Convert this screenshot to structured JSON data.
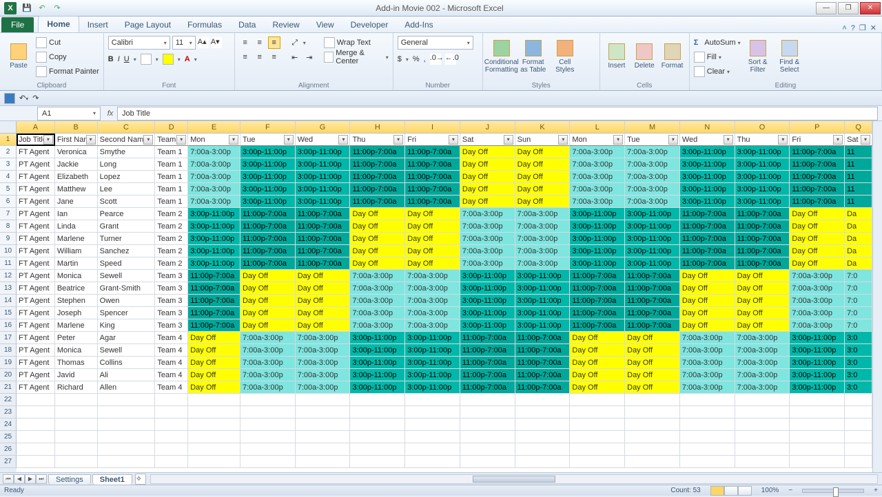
{
  "title": "Add-in Movie 002 - Microsoft Excel",
  "ribbon": {
    "file": "File",
    "tabs": [
      "Home",
      "Insert",
      "Page Layout",
      "Formulas",
      "Data",
      "Review",
      "View",
      "Developer",
      "Add-Ins"
    ],
    "active_tab": "Home",
    "clipboard": {
      "paste": "Paste",
      "cut": "Cut",
      "copy": "Copy",
      "fmtpainter": "Format Painter",
      "label": "Clipboard"
    },
    "font": {
      "name": "Calibri",
      "size": "11",
      "label": "Font"
    },
    "alignment": {
      "wrap": "Wrap Text",
      "merge": "Merge & Center",
      "label": "Alignment"
    },
    "number": {
      "format": "General",
      "label": "Number"
    },
    "styles": {
      "cond": "Conditional Formatting",
      "fmttbl": "Format as Table",
      "cellsty": "Cell Styles",
      "label": "Styles"
    },
    "cells": {
      "insert": "Insert",
      "delete": "Delete",
      "format": "Format",
      "label": "Cells"
    },
    "editing": {
      "autosum": "AutoSum",
      "fill": "Fill",
      "clear": "Clear",
      "sort": "Sort & Filter",
      "find": "Find & Select",
      "label": "Editing"
    }
  },
  "namebox": "A1",
  "formula": "Job Title",
  "columns": [
    {
      "letter": "A",
      "w": 56,
      "h": "Job Title"
    },
    {
      "letter": "B",
      "w": 62,
      "h": "First Name"
    },
    {
      "letter": "C",
      "w": 84,
      "h": "Second Name"
    },
    {
      "letter": "D",
      "w": 48,
      "h": "Team"
    },
    {
      "letter": "E",
      "w": 76,
      "h": "Mon"
    },
    {
      "letter": "F",
      "w": 80,
      "h": "Tue"
    },
    {
      "letter": "G",
      "w": 80,
      "h": "Wed"
    },
    {
      "letter": "H",
      "w": 80,
      "h": "Thu"
    },
    {
      "letter": "I",
      "w": 80,
      "h": "Fri"
    },
    {
      "letter": "J",
      "w": 80,
      "h": "Sat"
    },
    {
      "letter": "K",
      "w": 80,
      "h": "Sun"
    },
    {
      "letter": "L",
      "w": 80,
      "h": "Mon"
    },
    {
      "letter": "M",
      "w": 80,
      "h": "Tue"
    },
    {
      "letter": "N",
      "w": 80,
      "h": "Wed"
    },
    {
      "letter": "O",
      "w": 80,
      "h": "Thu"
    },
    {
      "letter": "P",
      "w": 80,
      "h": "Fri"
    },
    {
      "letter": "Q",
      "w": 40,
      "h": "Sat"
    }
  ],
  "shiftStyles": {
    "7:00a-3:00p": "c-m",
    "3:00p-11:00p": "c-a",
    "11:00p-7:00a": "c-n",
    "Day Off": "c-o"
  },
  "rows": [
    {
      "n": 2,
      "job": "FT Agent",
      "fn": "Veronica",
      "sn": "Smythe",
      "team": "Team 1",
      "s": [
        "7:00a-3:00p",
        "3:00p-11:00p",
        "3:00p-11:00p",
        "11:00p-7:00a",
        "11:00p-7:00a",
        "Day Off",
        "Day Off",
        "7:00a-3:00p",
        "7:00a-3:00p",
        "3:00p-11:00p",
        "3:00p-11:00p",
        "11:00p-7:00a",
        "11"
      ]
    },
    {
      "n": 3,
      "job": "PT Agent",
      "fn": "Jackie",
      "sn": "Long",
      "team": "Team 1",
      "s": [
        "7:00a-3:00p",
        "3:00p-11:00p",
        "3:00p-11:00p",
        "11:00p-7:00a",
        "11:00p-7:00a",
        "Day Off",
        "Day Off",
        "7:00a-3:00p",
        "7:00a-3:00p",
        "3:00p-11:00p",
        "3:00p-11:00p",
        "11:00p-7:00a",
        "11"
      ]
    },
    {
      "n": 4,
      "job": "FT Agent",
      "fn": "Elizabeth",
      "sn": "Lopez",
      "team": "Team 1",
      "s": [
        "7:00a-3:00p",
        "3:00p-11:00p",
        "3:00p-11:00p",
        "11:00p-7:00a",
        "11:00p-7:00a",
        "Day Off",
        "Day Off",
        "7:00a-3:00p",
        "7:00a-3:00p",
        "3:00p-11:00p",
        "3:00p-11:00p",
        "11:00p-7:00a",
        "11"
      ]
    },
    {
      "n": 5,
      "job": "FT Agent",
      "fn": "Matthew",
      "sn": "Lee",
      "team": "Team 1",
      "s": [
        "7:00a-3:00p",
        "3:00p-11:00p",
        "3:00p-11:00p",
        "11:00p-7:00a",
        "11:00p-7:00a",
        "Day Off",
        "Day Off",
        "7:00a-3:00p",
        "7:00a-3:00p",
        "3:00p-11:00p",
        "3:00p-11:00p",
        "11:00p-7:00a",
        "11"
      ]
    },
    {
      "n": 6,
      "job": "FT Agent",
      "fn": "Jane",
      "sn": "Scott",
      "team": "Team 1",
      "s": [
        "7:00a-3:00p",
        "3:00p-11:00p",
        "3:00p-11:00p",
        "11:00p-7:00a",
        "11:00p-7:00a",
        "Day Off",
        "Day Off",
        "7:00a-3:00p",
        "7:00a-3:00p",
        "3:00p-11:00p",
        "3:00p-11:00p",
        "11:00p-7:00a",
        "11"
      ]
    },
    {
      "n": 7,
      "job": "PT Agent",
      "fn": "Ian",
      "sn": "Pearce",
      "team": "Team 2",
      "s": [
        "3:00p-11:00p",
        "11:00p-7:00a",
        "11:00p-7:00a",
        "Day Off",
        "Day Off",
        "7:00a-3:00p",
        "7:00a-3:00p",
        "3:00p-11:00p",
        "3:00p-11:00p",
        "11:00p-7:00a",
        "11:00p-7:00a",
        "Day Off",
        "Da"
      ]
    },
    {
      "n": 8,
      "job": "FT Agent",
      "fn": "Linda",
      "sn": "Grant",
      "team": "Team 2",
      "s": [
        "3:00p-11:00p",
        "11:00p-7:00a",
        "11:00p-7:00a",
        "Day Off",
        "Day Off",
        "7:00a-3:00p",
        "7:00a-3:00p",
        "3:00p-11:00p",
        "3:00p-11:00p",
        "11:00p-7:00a",
        "11:00p-7:00a",
        "Day Off",
        "Da"
      ]
    },
    {
      "n": 9,
      "job": "FT Agent",
      "fn": "Marlene",
      "sn": "Turner",
      "team": "Team 2",
      "s": [
        "3:00p-11:00p",
        "11:00p-7:00a",
        "11:00p-7:00a",
        "Day Off",
        "Day Off",
        "7:00a-3:00p",
        "7:00a-3:00p",
        "3:00p-11:00p",
        "3:00p-11:00p",
        "11:00p-7:00a",
        "11:00p-7:00a",
        "Day Off",
        "Da"
      ]
    },
    {
      "n": 10,
      "job": "FT Agent",
      "fn": "William",
      "sn": "Sanchez",
      "team": "Team 2",
      "s": [
        "3:00p-11:00p",
        "11:00p-7:00a",
        "11:00p-7:00a",
        "Day Off",
        "Day Off",
        "7:00a-3:00p",
        "7:00a-3:00p",
        "3:00p-11:00p",
        "3:00p-11:00p",
        "11:00p-7:00a",
        "11:00p-7:00a",
        "Day Off",
        "Da"
      ]
    },
    {
      "n": 11,
      "job": "FT Agent",
      "fn": "Martin",
      "sn": "Speed",
      "team": "Team 2",
      "s": [
        "3:00p-11:00p",
        "11:00p-7:00a",
        "11:00p-7:00a",
        "Day Off",
        "Day Off",
        "7:00a-3:00p",
        "7:00a-3:00p",
        "3:00p-11:00p",
        "3:00p-11:00p",
        "11:00p-7:00a",
        "11:00p-7:00a",
        "Day Off",
        "Da"
      ]
    },
    {
      "n": 12,
      "job": "PT Agent",
      "fn": "Monica",
      "sn": "Sewell",
      "team": "Team 3",
      "s": [
        "11:00p-7:00a",
        "Day Off",
        "Day Off",
        "7:00a-3:00p",
        "7:00a-3:00p",
        "3:00p-11:00p",
        "3:00p-11:00p",
        "11:00p-7:00a",
        "11:00p-7:00a",
        "Day Off",
        "Day Off",
        "7:00a-3:00p",
        "7:0"
      ]
    },
    {
      "n": 13,
      "job": "FT Agent",
      "fn": "Beatrice",
      "sn": "Grant-Smith",
      "team": "Team 3",
      "s": [
        "11:00p-7:00a",
        "Day Off",
        "Day Off",
        "7:00a-3:00p",
        "7:00a-3:00p",
        "3:00p-11:00p",
        "3:00p-11:00p",
        "11:00p-7:00a",
        "11:00p-7:00a",
        "Day Off",
        "Day Off",
        "7:00a-3:00p",
        "7:0"
      ]
    },
    {
      "n": 14,
      "job": "PT Agent",
      "fn": "Stephen",
      "sn": "Owen",
      "team": "Team 3",
      "s": [
        "11:00p-7:00a",
        "Day Off",
        "Day Off",
        "7:00a-3:00p",
        "7:00a-3:00p",
        "3:00p-11:00p",
        "3:00p-11:00p",
        "11:00p-7:00a",
        "11:00p-7:00a",
        "Day Off",
        "Day Off",
        "7:00a-3:00p",
        "7:0"
      ]
    },
    {
      "n": 15,
      "job": "FT Agent",
      "fn": "Joseph",
      "sn": "Spencer",
      "team": "Team 3",
      "s": [
        "11:00p-7:00a",
        "Day Off",
        "Day Off",
        "7:00a-3:00p",
        "7:00a-3:00p",
        "3:00p-11:00p",
        "3:00p-11:00p",
        "11:00p-7:00a",
        "11:00p-7:00a",
        "Day Off",
        "Day Off",
        "7:00a-3:00p",
        "7:0"
      ]
    },
    {
      "n": 16,
      "job": "FT Agent",
      "fn": "Marlene",
      "sn": "King",
      "team": "Team 3",
      "s": [
        "11:00p-7:00a",
        "Day Off",
        "Day Off",
        "7:00a-3:00p",
        "7:00a-3:00p",
        "3:00p-11:00p",
        "3:00p-11:00p",
        "11:00p-7:00a",
        "11:00p-7:00a",
        "Day Off",
        "Day Off",
        "7:00a-3:00p",
        "7:0"
      ]
    },
    {
      "n": 17,
      "job": "FT Agent",
      "fn": "Peter",
      "sn": "Agar",
      "team": "Team 4",
      "s": [
        "Day Off",
        "7:00a-3:00p",
        "7:00a-3:00p",
        "3:00p-11:00p",
        "3:00p-11:00p",
        "11:00p-7:00a",
        "11:00p-7:00a",
        "Day Off",
        "Day Off",
        "7:00a-3:00p",
        "7:00a-3:00p",
        "3:00p-11:00p",
        "3:0"
      ]
    },
    {
      "n": 18,
      "job": "PT Agent",
      "fn": "Monica",
      "sn": "Sewell",
      "team": "Team 4",
      "s": [
        "Day Off",
        "7:00a-3:00p",
        "7:00a-3:00p",
        "3:00p-11:00p",
        "3:00p-11:00p",
        "11:00p-7:00a",
        "11:00p-7:00a",
        "Day Off",
        "Day Off",
        "7:00a-3:00p",
        "7:00a-3:00p",
        "3:00p-11:00p",
        "3:0"
      ]
    },
    {
      "n": 19,
      "job": "FT Agent",
      "fn": "Thomas",
      "sn": "Collins",
      "team": "Team 4",
      "s": [
        "Day Off",
        "7:00a-3:00p",
        "7:00a-3:00p",
        "3:00p-11:00p",
        "3:00p-11:00p",
        "11:00p-7:00a",
        "11:00p-7:00a",
        "Day Off",
        "Day Off",
        "7:00a-3:00p",
        "7:00a-3:00p",
        "3:00p-11:00p",
        "3:0"
      ]
    },
    {
      "n": 20,
      "job": "PT Agent",
      "fn": "Javid",
      "sn": "Ali",
      "team": "Team 4",
      "s": [
        "Day Off",
        "7:00a-3:00p",
        "7:00a-3:00p",
        "3:00p-11:00p",
        "3:00p-11:00p",
        "11:00p-7:00a",
        "11:00p-7:00a",
        "Day Off",
        "Day Off",
        "7:00a-3:00p",
        "7:00a-3:00p",
        "3:00p-11:00p",
        "3:0"
      ]
    },
    {
      "n": 21,
      "job": "FT Agent",
      "fn": "Richard",
      "sn": "Allen",
      "team": "Team 4",
      "s": [
        "Day Off",
        "7:00a-3:00p",
        "7:00a-3:00p",
        "3:00p-11:00p",
        "3:00p-11:00p",
        "11:00p-7:00a",
        "11:00p-7:00a",
        "Day Off",
        "Day Off",
        "7:00a-3:00p",
        "7:00a-3:00p",
        "3:00p-11:00p",
        "3:0"
      ]
    }
  ],
  "emptyRows": [
    22,
    23,
    24,
    25,
    26,
    27
  ],
  "sheets": {
    "tabs": [
      "Settings",
      "Sheet1"
    ],
    "active": "Sheet1"
  },
  "status": {
    "ready": "Ready",
    "count_label": "Count:",
    "count": "53",
    "zoom": "100%"
  }
}
